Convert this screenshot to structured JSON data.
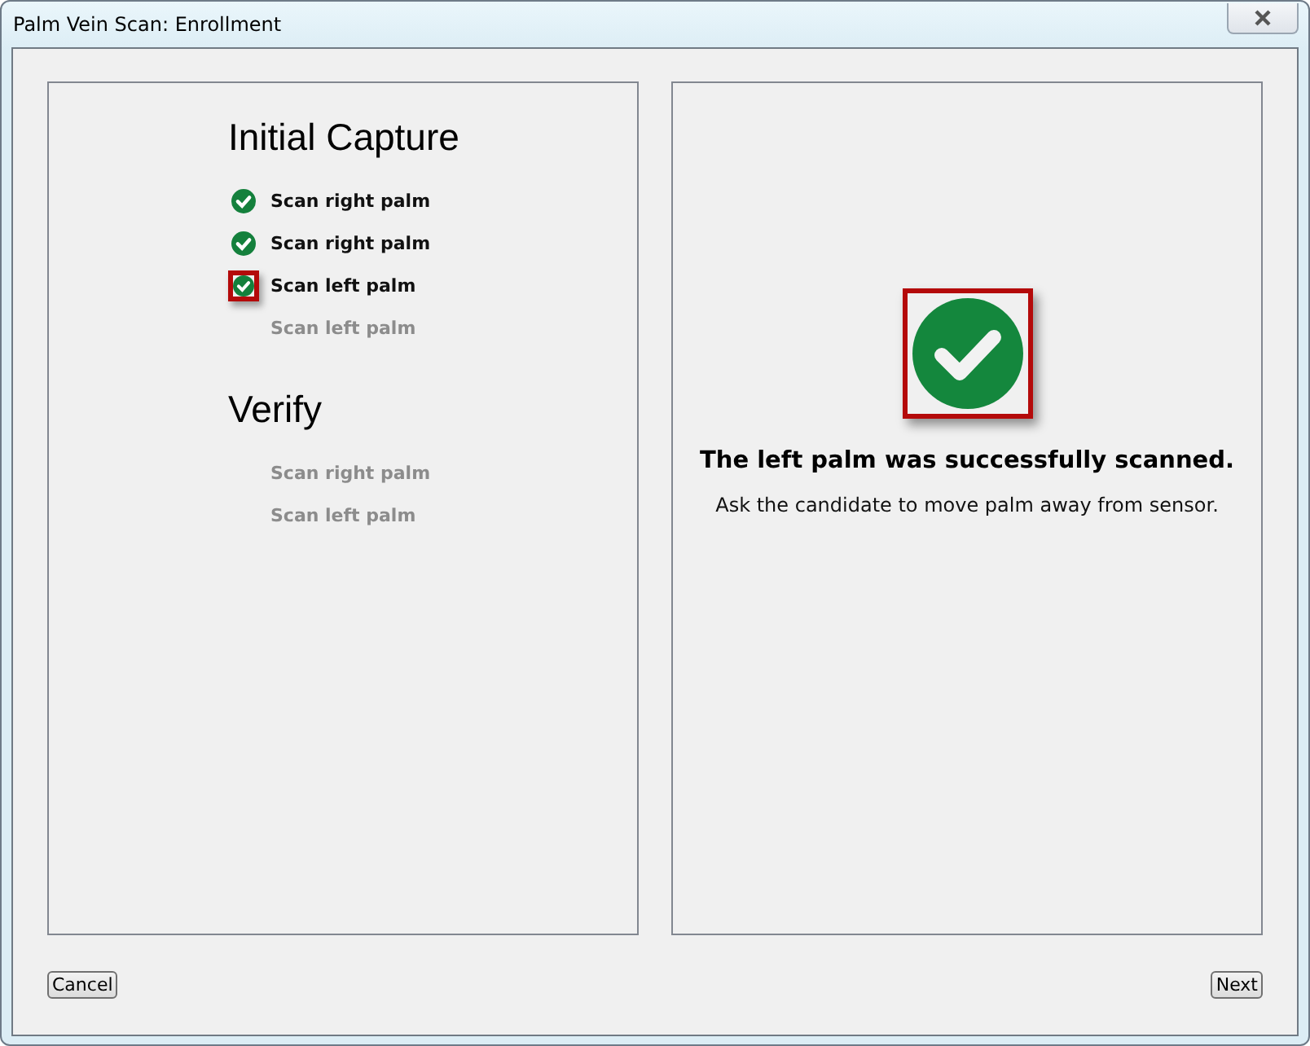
{
  "window": {
    "title": "Palm Vein Scan: Enrollment"
  },
  "sections": [
    {
      "title": "Initial Capture",
      "steps": [
        {
          "label": "Scan right palm",
          "done": true,
          "highlighted": false
        },
        {
          "label": "Scan right palm",
          "done": true,
          "highlighted": false
        },
        {
          "label": "Scan left palm",
          "done": true,
          "highlighted": true
        },
        {
          "label": "Scan left palm",
          "done": false,
          "highlighted": false
        }
      ]
    },
    {
      "title": "Verify",
      "steps": [
        {
          "label": "Scan right palm",
          "done": false,
          "highlighted": false
        },
        {
          "label": "Scan left palm",
          "done": false,
          "highlighted": false
        }
      ]
    }
  ],
  "result": {
    "highlighted": true,
    "heading": "The left palm was successfully scanned.",
    "message": "Ask the candidate to move palm away from sensor."
  },
  "buttons": {
    "cancel": "Cancel",
    "next": "Next"
  }
}
